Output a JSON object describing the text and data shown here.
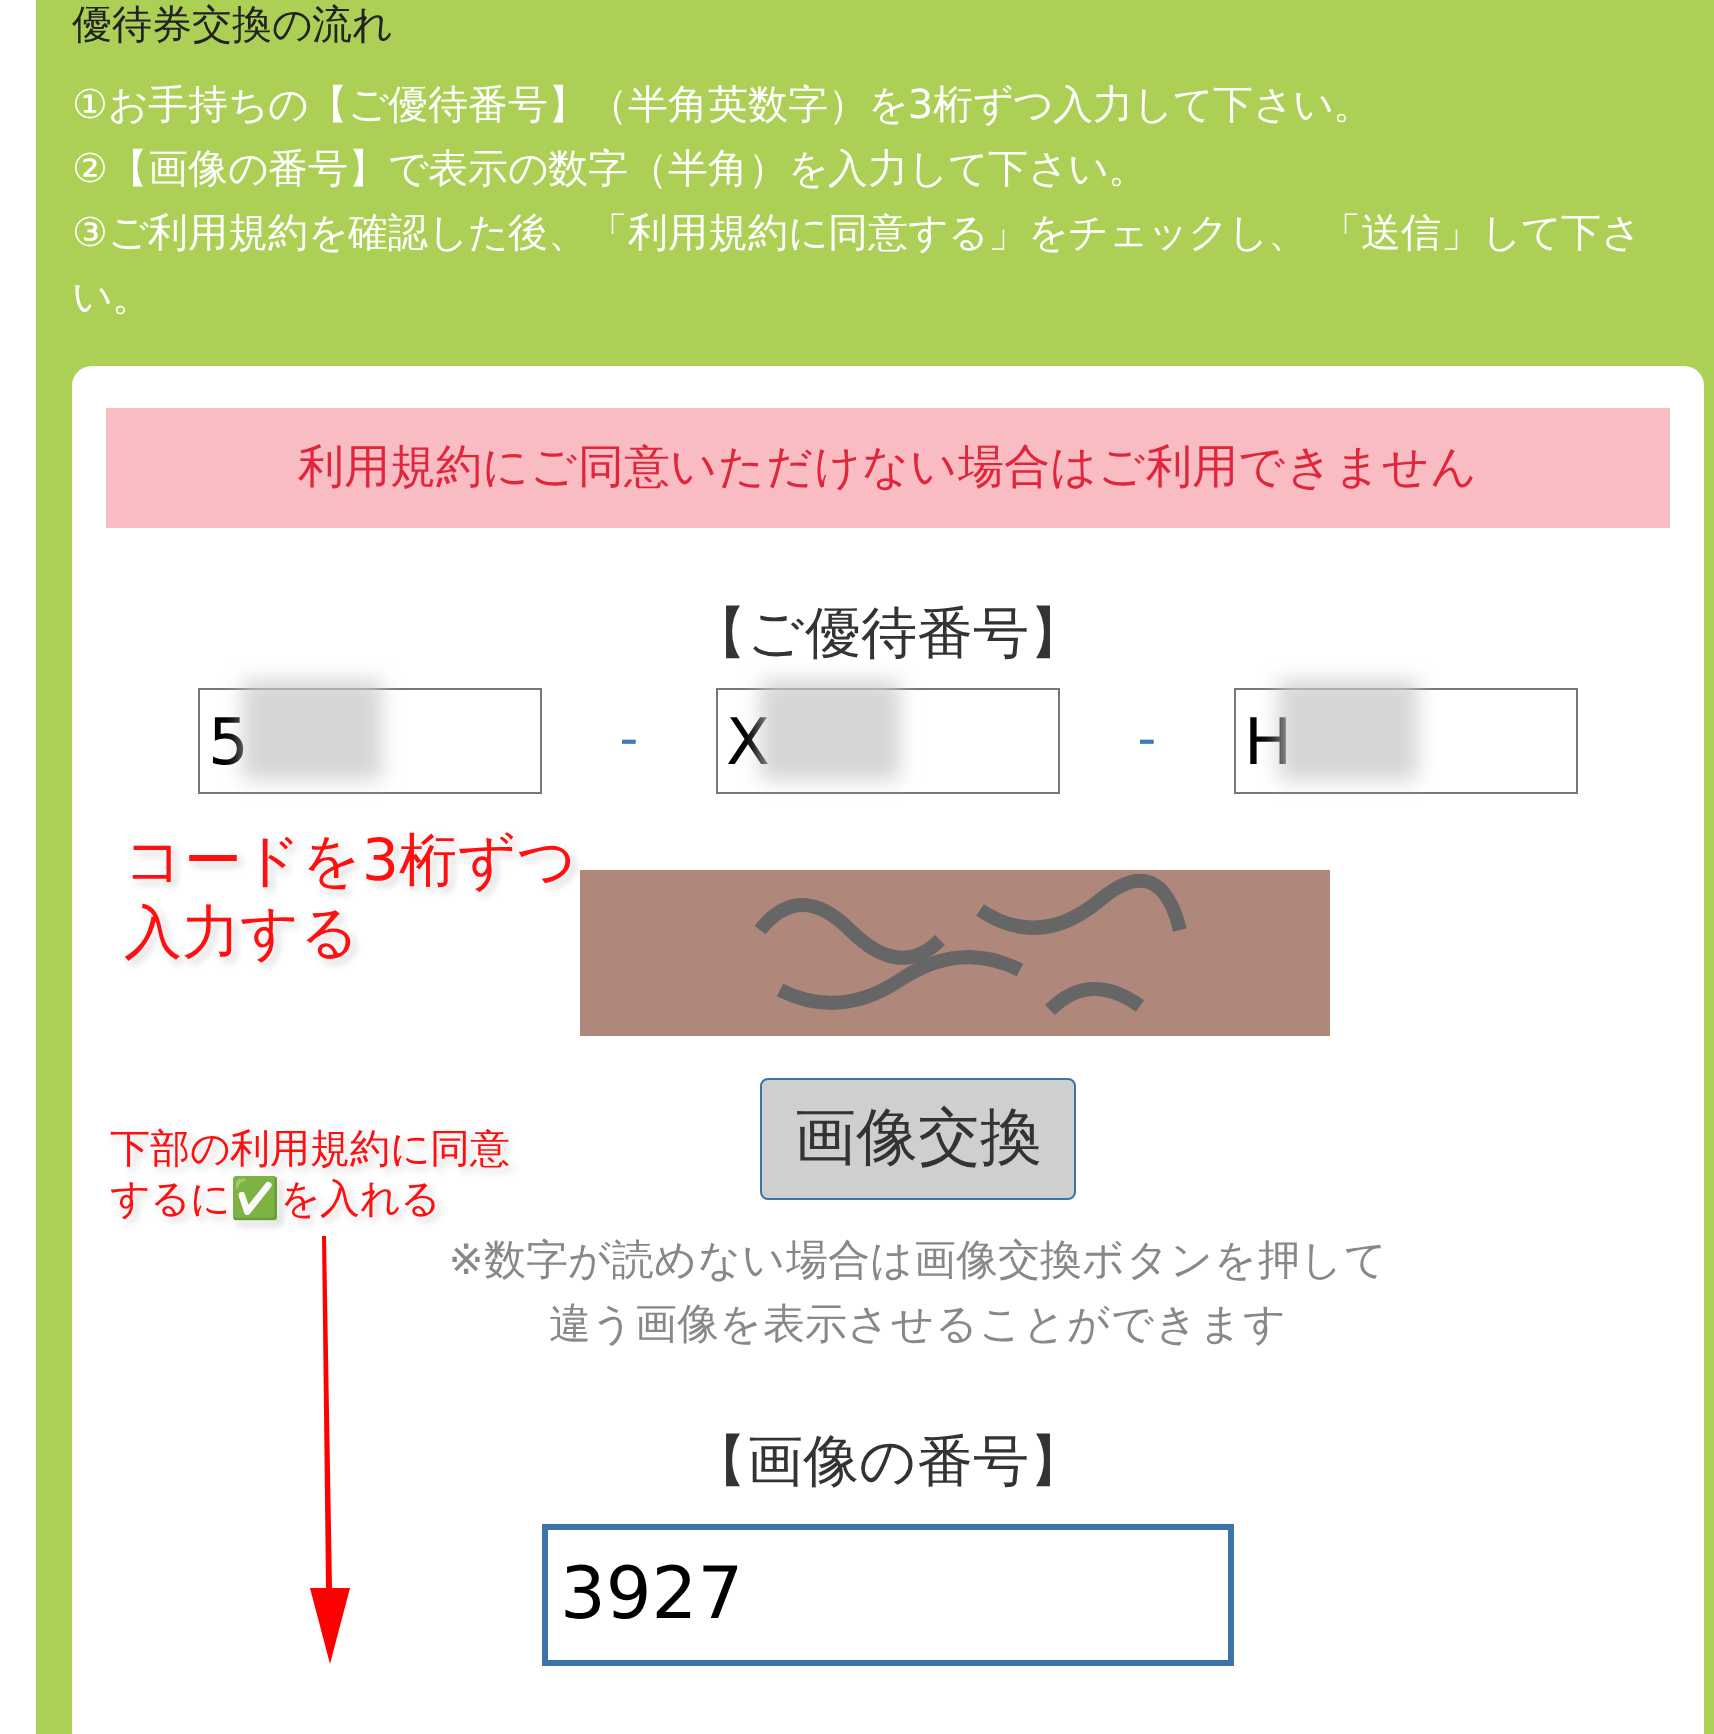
{
  "heading": "優待券交換の流れ",
  "instructions": [
    "①お手持ちの【ご優待番号】（半角英数字）を3桁ずつ入力して下さい。",
    "②【画像の番号】で表示の数字（半角）を入力して下さい。",
    "③ご利用規約を確認した後、「利用規約に同意する」をチェックし、 「送信」して下さい。"
  ],
  "notice": "利用規約にご同意いただけない場合はご利用できません",
  "code_title": "【ご優待番号】",
  "code_fields": [
    {
      "value": "5"
    },
    {
      "value": "X"
    },
    {
      "value": "H"
    }
  ],
  "separator": "-",
  "captcha": {
    "kind": "picture"
  },
  "refresh_button": "画像交換",
  "hint_lines": [
    "※数字が読めない場合は画像交換ボタンを押して",
    "違う画像を表示させることができます"
  ],
  "image_number_title": "【画像の番号】",
  "image_number_field": {
    "value": "3927"
  },
  "annotations": [
    {
      "lines": [
        "コードを3桁ずつ",
        "入力する"
      ]
    },
    {
      "lines": [
        "下部の利用規約に同意",
        "するに✅を入れる"
      ]
    }
  ]
}
